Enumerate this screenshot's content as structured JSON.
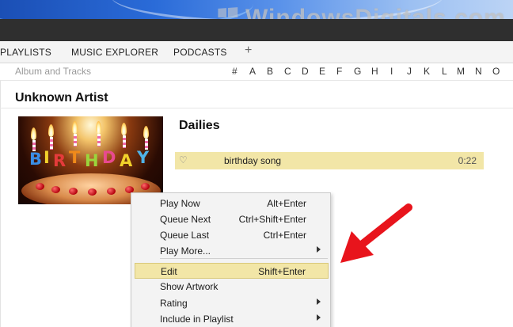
{
  "watermark": {
    "text": "WindowsDigitals.com"
  },
  "tabs": [
    "PLAYLISTS",
    "MUSIC EXPLORER",
    "PODCASTS"
  ],
  "tab_add_label": "+",
  "subheader": {
    "label": "Album and Tracks",
    "alphabet": [
      "#",
      "A",
      "B",
      "C",
      "D",
      "E",
      "F",
      "G",
      "H",
      "I",
      "J",
      "K",
      "L",
      "M",
      "N",
      "O"
    ]
  },
  "artist": "Unknown Artist",
  "album": {
    "title": "Dailies",
    "artwork_icon": "birthday-cake-artwork",
    "artwork_text": "BIRTHDAY"
  },
  "tracks": [
    {
      "favorite_icon": "heart-outline-icon",
      "title": "birthday song",
      "duration": "0:22"
    }
  ],
  "context_menu": {
    "items": [
      {
        "label": "Play Now",
        "shortcut": "Alt+Enter",
        "submenu": false
      },
      {
        "label": "Queue Next",
        "shortcut": "Ctrl+Shift+Enter",
        "submenu": false
      },
      {
        "label": "Queue Last",
        "shortcut": "Ctrl+Enter",
        "submenu": false
      },
      {
        "label": "Play More...",
        "shortcut": "",
        "submenu": true
      },
      {
        "label": "Edit",
        "shortcut": "Shift+Enter",
        "submenu": false,
        "highlighted": true
      },
      {
        "label": "Show Artwork",
        "shortcut": "",
        "submenu": false
      },
      {
        "label": "Rating",
        "shortcut": "",
        "submenu": true
      },
      {
        "label": "Include in Playlist",
        "shortcut": "",
        "submenu": true
      }
    ]
  },
  "colors": {
    "highlight": "#f2e6a7",
    "annotation_arrow": "#e8141c",
    "titlebar": "#2f2f2f"
  }
}
